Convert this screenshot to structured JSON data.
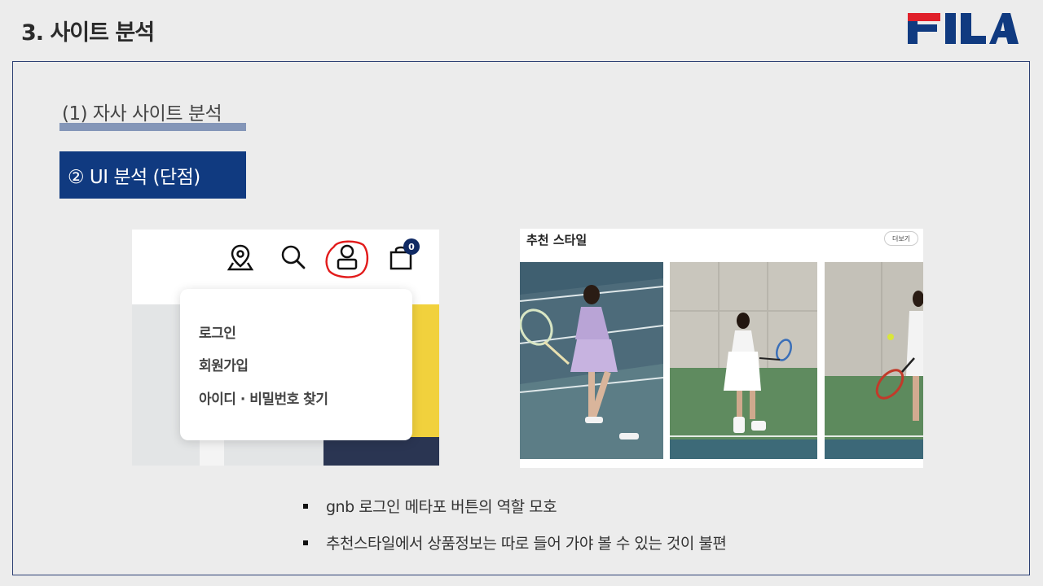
{
  "slide": {
    "title": "3. 사이트 분석",
    "logo_text": "FILA",
    "subtitle": "(1) 자사 사이트 분석",
    "badge": "② UI 분석 (단점)"
  },
  "gnb_screenshot": {
    "cart_count": "0",
    "menu": [
      "로그인",
      "회원가입",
      "아이디 · 비밀번호 찾기"
    ]
  },
  "style_screenshot": {
    "title": "추천 스타일",
    "more_label": "더보기"
  },
  "bullets": [
    "gnb 로그인 메타포 버튼의 역할 모호",
    "추천스타일에서 상품정보는 따로 들어 가야 볼 수 있는 것이 불편"
  ],
  "colors": {
    "brand_navy": "#103a80",
    "brand_red": "#e0202a",
    "frame_border": "#2c3f73",
    "highlight_circle": "#e21b1b"
  }
}
